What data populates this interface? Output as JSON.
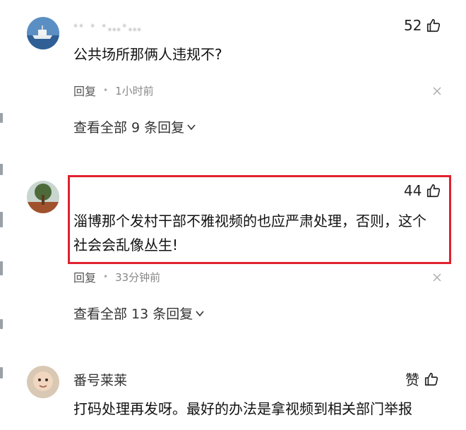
{
  "comments": [
    {
      "username": "·· · ·…·…",
      "likes": "52",
      "text": "公共场所那俩人违规不?",
      "reply_label": "回复",
      "time": "1小时前",
      "view_all": "查看全部 9 条回复",
      "avatar": "ship-avatar"
    },
    {
      "username": "",
      "likes": "44",
      "text_line1": "淄博那个发村干部不雅视频的也应严肃处理，否则，这个",
      "text_line2": "社会会乱像丛生!",
      "reply_label": "回复",
      "time": "33分钟前",
      "view_all": "查看全部 13 条回复",
      "avatar": "tree-avatar"
    },
    {
      "username": "番号莱莱",
      "likes": "赞",
      "text": "打码处理再发呀。最好的办法是拿视频到相关部门举报",
      "avatar": "baby-avatar"
    }
  ],
  "colors": {
    "highlight": "#e0212e",
    "meta": "#888888"
  },
  "icons": [
    "thumbs-up-icon",
    "close-icon",
    "chevron-down-icon"
  ]
}
